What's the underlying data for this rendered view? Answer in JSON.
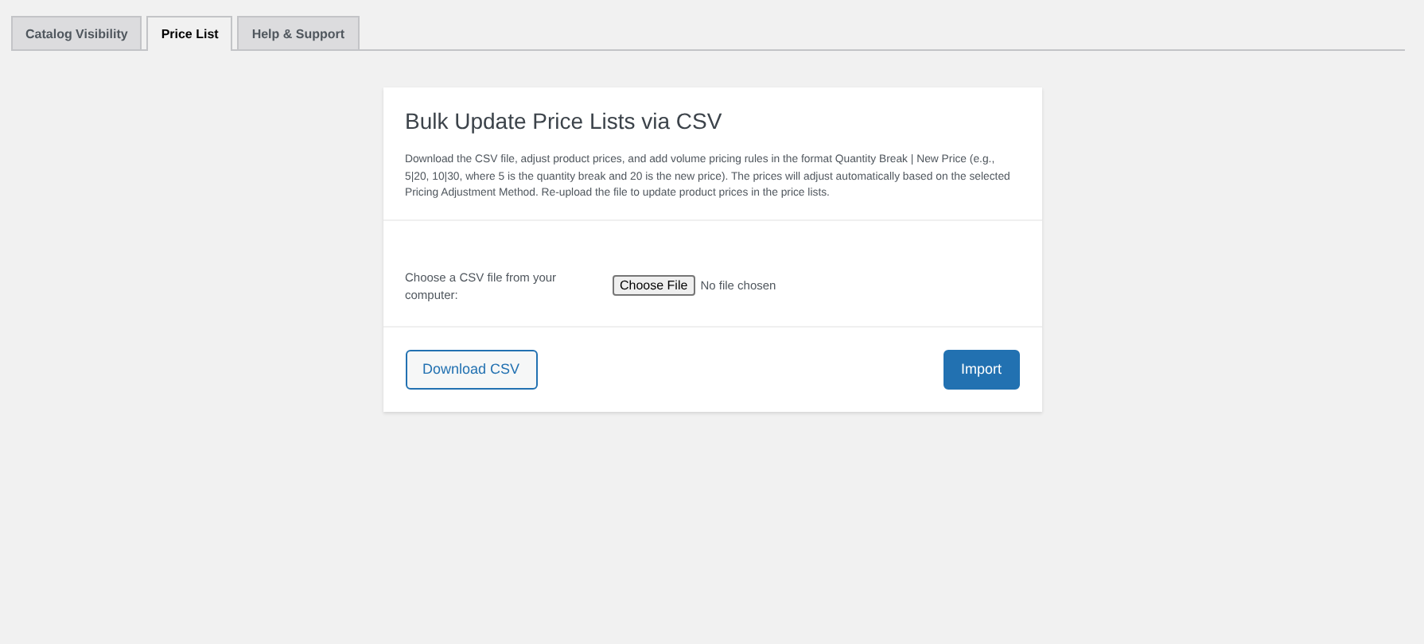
{
  "tabs": [
    {
      "label": "Catalog Visibility",
      "selected": false
    },
    {
      "label": "Price List",
      "selected": true
    },
    {
      "label": "Help & Support",
      "selected": false
    }
  ],
  "card": {
    "title": "Bulk Update Price Lists via CSV",
    "description": "Download the CSV file, adjust product prices, and add volume pricing rules in the format Quantity Break | New Price (e.g., 5|20, 10|30, where 5 is the quantity break and 20 is the new price). The prices will adjust automatically based on the selected Pricing Adjustment Method. Re-upload the file to update product prices in the price lists.",
    "file_label": "Choose a CSV file from your computer:",
    "file_button": "Choose File",
    "file_status": "No file chosen",
    "buttons": [
      {
        "label": "Download CSV",
        "kind": "secondary"
      },
      {
        "label": "Import",
        "kind": "primary"
      }
    ]
  }
}
